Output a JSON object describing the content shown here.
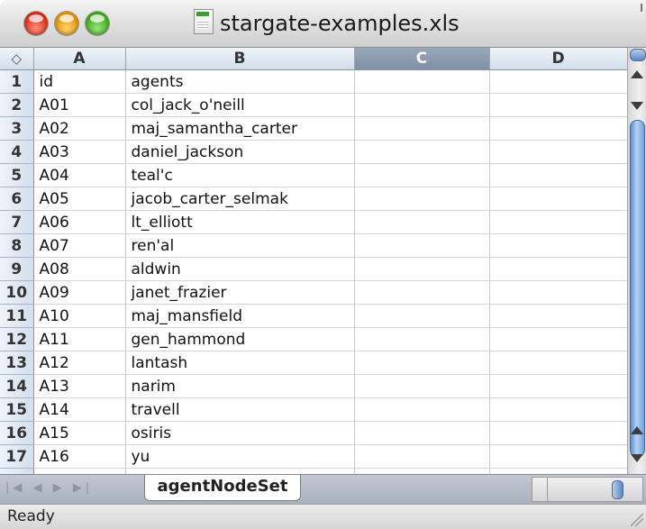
{
  "window": {
    "title": "stargate-examples.xls",
    "status": "Ready"
  },
  "grid": {
    "select_all_glyph": "◇",
    "columns": [
      "A",
      "B",
      "C",
      "D"
    ],
    "selected_column": "C",
    "rows": [
      {
        "num": "1",
        "a": "id",
        "b": "agents"
      },
      {
        "num": "2",
        "a": "A01",
        "b": "col_jack_o'neill"
      },
      {
        "num": "3",
        "a": "A02",
        "b": "maj_samantha_carter"
      },
      {
        "num": "4",
        "a": "A03",
        "b": "daniel_jackson"
      },
      {
        "num": "5",
        "a": "A04",
        "b": "teal'c"
      },
      {
        "num": "6",
        "a": "A05",
        "b": "jacob_carter_selmak"
      },
      {
        "num": "7",
        "a": "A06",
        "b": "lt_elliott"
      },
      {
        "num": "8",
        "a": "A07",
        "b": "ren'al"
      },
      {
        "num": "9",
        "a": "A08",
        "b": "aldwin"
      },
      {
        "num": "10",
        "a": "A09",
        "b": "janet_frazier"
      },
      {
        "num": "11",
        "a": "A10",
        "b": "maj_mansfield"
      },
      {
        "num": "12",
        "a": "A11",
        "b": "gen_hammond"
      },
      {
        "num": "13",
        "a": "A12",
        "b": "lantash"
      },
      {
        "num": "14",
        "a": "A13",
        "b": "narim"
      },
      {
        "num": "15",
        "a": "A14",
        "b": "travell"
      },
      {
        "num": "16",
        "a": "A15",
        "b": "osiris"
      },
      {
        "num": "17",
        "a": "A16",
        "b": "yu"
      }
    ]
  },
  "sheet_tabs": {
    "nav_glyphs": [
      "|◀",
      "◀",
      "▶",
      "▶|"
    ],
    "active_tab": "agentNodeSet"
  },
  "icons": {
    "close": "close-button-icon",
    "minimize": "minimize-button-icon",
    "zoom": "zoom-button-icon",
    "document": "spreadsheet-document-icon"
  },
  "colors": {
    "header_bg": "#d3deeb",
    "selected_header_bg": "#8a98ac",
    "close": "#d8230f",
    "minimize": "#e08a00",
    "zoom": "#36a512",
    "scroll_thumb": "#6f9ee0"
  }
}
